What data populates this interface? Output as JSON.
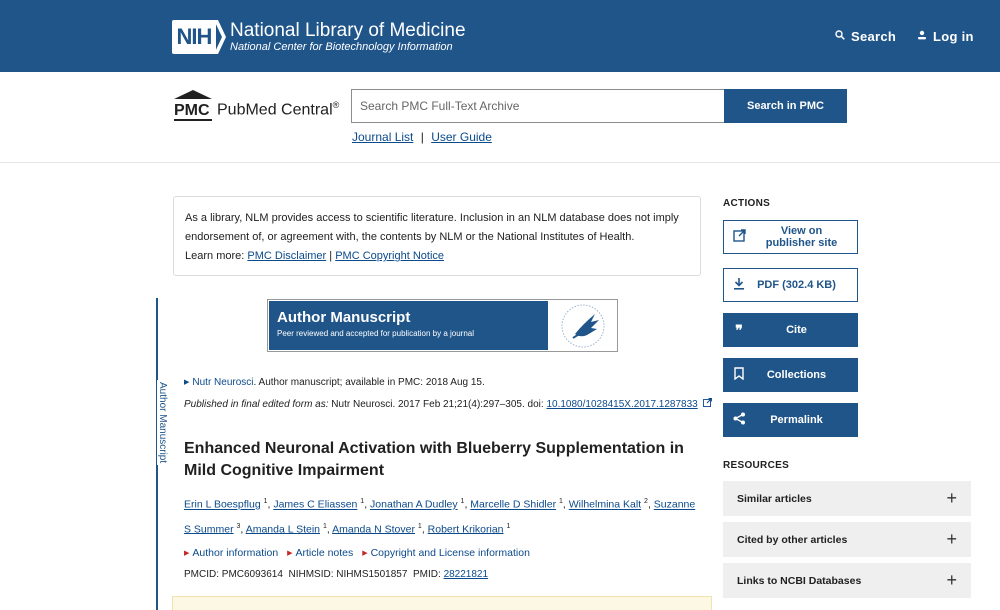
{
  "header": {
    "logo_mark": "NIH",
    "logo_title": "National Library of Medicine",
    "logo_subtitle": "National Center for Biotechnology Information",
    "search_label": "Search",
    "login_label": "Log in"
  },
  "pmc": {
    "logo_mark": "PMC",
    "logo_name": "PubMed Central",
    "logo_reg": "®",
    "search_placeholder": "Search PMC Full-Text Archive",
    "search_button": "Search in PMC",
    "journal_list": "Journal List",
    "separator": "|",
    "user_guide": "User Guide"
  },
  "disclaimer": {
    "text": "As a library, NLM provides access to scientific literature. Inclusion in an NLM database does not imply endorsement of, or agreement with, the contents by NLM or the National Institutes of Health.",
    "learn_more": "Learn more:",
    "link1": "PMC Disclaimer",
    "sep": "|",
    "link2": "PMC Copyright Notice"
  },
  "author_manuscript": {
    "vertical_label": "Author Manuscript",
    "banner_title": "Author Manuscript",
    "banner_subtitle": "Peer reviewed and accepted for publication by a journal"
  },
  "article": {
    "journal": "Nutr Neurosci",
    "availability": ". Author manuscript; available in PMC: 2018 Aug 15.",
    "published_label": "Published in final edited form as:",
    "citation": " Nutr Neurosci. 2017 Feb 21;21(4):297–305. doi: ",
    "doi": "10.1080/1028415X.2017.1287833",
    "title": "Enhanced Neuronal Activation with Blueberry Supplementation in Mild Cognitive Impairment",
    "authors": [
      {
        "name": "Erin L Boespflug",
        "aff": "1"
      },
      {
        "name": "James C Eliassen",
        "aff": "1"
      },
      {
        "name": "Jonathan A Dudley",
        "aff": "1"
      },
      {
        "name": "Marcelle D Shidler",
        "aff": "1"
      },
      {
        "name": "Wilhelmina Kalt",
        "aff": "2"
      },
      {
        "name": "Suzanne S Summer",
        "aff": "3"
      },
      {
        "name": "Amanda L Stein",
        "aff": "1"
      },
      {
        "name": "Amanda N Stover",
        "aff": "1"
      },
      {
        "name": "Robert Krikorian",
        "aff": "1"
      }
    ],
    "author_info": "Author information",
    "article_notes": "Article notes",
    "copyright": "Copyright and License information",
    "pmcid_label": "PMCID: PMC6093614",
    "nihmsid_label": "NIHMSID: NIHMS1501857",
    "pmid_label": "PMID:",
    "pmid": "28221821"
  },
  "sidebar": {
    "actions_heading": "ACTIONS",
    "view_publisher": "View on publisher site",
    "pdf": "PDF (302.4 KB)",
    "cite": "Cite",
    "collections": "Collections",
    "permalink": "Permalink",
    "resources_heading": "RESOURCES",
    "resources": [
      {
        "label": "Similar articles"
      },
      {
        "label": "Cited by other articles"
      },
      {
        "label": "Links to NCBI Databases"
      }
    ]
  },
  "colors": {
    "brand_blue": "#20558a",
    "link_blue": "#0b4a8b"
  }
}
